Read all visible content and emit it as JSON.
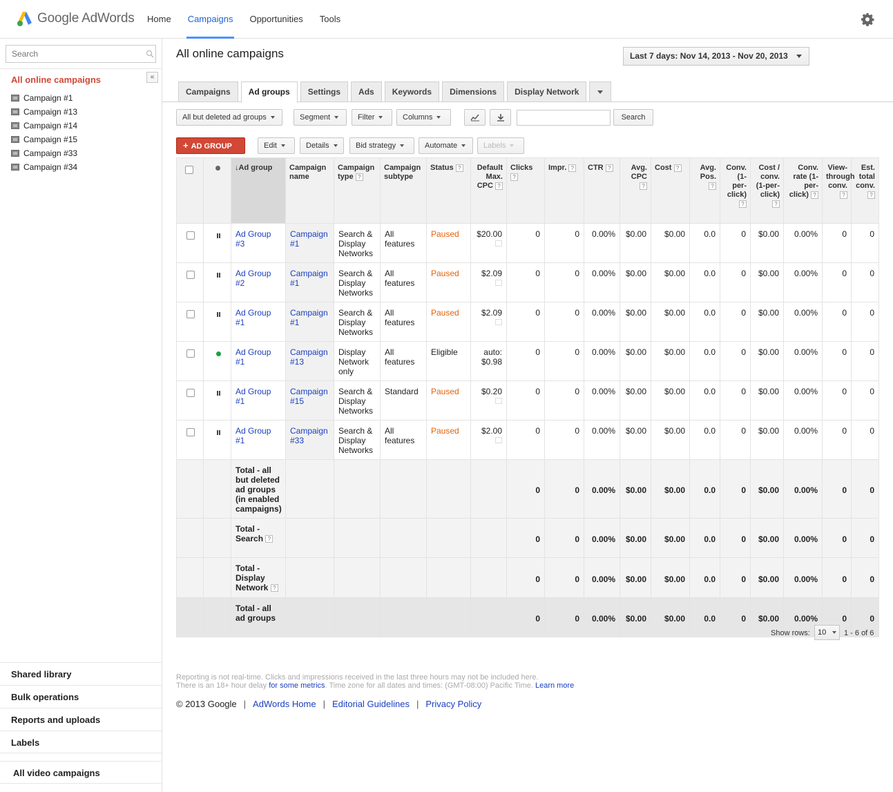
{
  "header": {
    "logo_google": "Google",
    "logo_adwords": "AdWords",
    "nav": [
      "Home",
      "Campaigns",
      "Opportunities",
      "Tools"
    ],
    "active_nav": "Campaigns"
  },
  "sidebar": {
    "search_placeholder": "Search",
    "collapse_label": "«",
    "all_campaigns": "All online campaigns",
    "campaigns": [
      "Campaign #1",
      "Campaign #13",
      "Campaign #14",
      "Campaign #15",
      "Campaign #33",
      "Campaign #34"
    ],
    "bottom_links": [
      "Shared library",
      "Bulk operations",
      "Reports and uploads",
      "Labels",
      "All video campaigns"
    ]
  },
  "main": {
    "title": "All online campaigns",
    "date_range": "Last 7 days: Nov 14, 2013 - Nov 20, 2013",
    "tabs": [
      "Campaigns",
      "Ad groups",
      "Settings",
      "Ads",
      "Keywords",
      "Dimensions",
      "Display Network"
    ],
    "active_tab": "Ad groups",
    "toolbar": {
      "filter_view": "All but deleted ad groups",
      "segment": "Segment",
      "filter": "Filter",
      "columns": "Columns",
      "search_button": "Search"
    },
    "actions": {
      "add": "AD GROUP",
      "edit": "Edit",
      "details": "Details",
      "bid_strategy": "Bid strategy",
      "automate": "Automate",
      "labels": "Labels"
    }
  },
  "table": {
    "headers": {
      "ad_group": "Ad group",
      "campaign_name": "Campaign name",
      "campaign_type": "Campaign type",
      "campaign_subtype": "Campaign subtype",
      "status": "Status",
      "default_cpc": "Default Max. CPC",
      "clicks": "Clicks",
      "impr": "Impr.",
      "ctr": "CTR",
      "avg_cpc": "Avg. CPC",
      "cost": "Cost",
      "avg_pos": "Avg. Pos.",
      "conv": "Conv. (1-per-click)",
      "cost_conv": "Cost / conv. (1-per-click)",
      "conv_rate": "Conv. rate (1-per-click)",
      "view_through": "View-through conv.",
      "est_total": "Est. total conv."
    },
    "rows": [
      {
        "state": "paused",
        "ad_group": "Ad Group #3",
        "campaign": "Campaign #1",
        "type": "Search & Display Networks",
        "subtype": "All features",
        "status": "Paused",
        "cpc": "$20.00",
        "clicks": "0",
        "impr": "0",
        "ctr": "0.00%",
        "avg_cpc": "$0.00",
        "cost": "$0.00",
        "avg_pos": "0.0",
        "conv": "0",
        "cost_conv": "$0.00",
        "conv_rate": "0.00%",
        "view_through": "0",
        "est_total": "0"
      },
      {
        "state": "paused",
        "ad_group": "Ad Group #2",
        "campaign": "Campaign #1",
        "type": "Search & Display Networks",
        "subtype": "All features",
        "status": "Paused",
        "cpc": "$2.09",
        "clicks": "0",
        "impr": "0",
        "ctr": "0.00%",
        "avg_cpc": "$0.00",
        "cost": "$0.00",
        "avg_pos": "0.0",
        "conv": "0",
        "cost_conv": "$0.00",
        "conv_rate": "0.00%",
        "view_through": "0",
        "est_total": "0"
      },
      {
        "state": "paused",
        "ad_group": "Ad Group #1",
        "campaign": "Campaign #1",
        "type": "Search & Display Networks",
        "subtype": "All features",
        "status": "Paused",
        "cpc": "$2.09",
        "clicks": "0",
        "impr": "0",
        "ctr": "0.00%",
        "avg_cpc": "$0.00",
        "cost": "$0.00",
        "avg_pos": "0.0",
        "conv": "0",
        "cost_conv": "$0.00",
        "conv_rate": "0.00%",
        "view_through": "0",
        "est_total": "0"
      },
      {
        "state": "eligible",
        "ad_group": "Ad Group #1",
        "campaign": "Campaign #13",
        "type": "Display Network only",
        "subtype": "All features",
        "status": "Eligible",
        "cpc": "auto: $0.98",
        "clicks": "0",
        "impr": "0",
        "ctr": "0.00%",
        "avg_cpc": "$0.00",
        "cost": "$0.00",
        "avg_pos": "0.0",
        "conv": "0",
        "cost_conv": "$0.00",
        "conv_rate": "0.00%",
        "view_through": "0",
        "est_total": "0"
      },
      {
        "state": "paused",
        "ad_group": "Ad Group #1",
        "campaign": "Campaign #15",
        "type": "Search & Display Networks",
        "subtype": "Standard",
        "status": "Paused",
        "cpc": "$0.20",
        "clicks": "0",
        "impr": "0",
        "ctr": "0.00%",
        "avg_cpc": "$0.00",
        "cost": "$0.00",
        "avg_pos": "0.0",
        "conv": "0",
        "cost_conv": "$0.00",
        "conv_rate": "0.00%",
        "view_through": "0",
        "est_total": "0"
      },
      {
        "state": "paused",
        "ad_group": "Ad Group #1",
        "campaign": "Campaign #33",
        "type": "Search & Display Networks",
        "subtype": "All features",
        "status": "Paused",
        "cpc": "$2.00",
        "clicks": "0",
        "impr": "0",
        "ctr": "0.00%",
        "avg_cpc": "$0.00",
        "cost": "$0.00",
        "avg_pos": "0.0",
        "conv": "0",
        "cost_conv": "$0.00",
        "conv_rate": "0.00%",
        "view_through": "0",
        "est_total": "0"
      }
    ],
    "totals": [
      {
        "label": "Total - all but deleted ad groups (in enabled campaigns)",
        "help": false,
        "clicks": "0",
        "impr": "0",
        "ctr": "0.00%",
        "avg_cpc": "$0.00",
        "cost": "$0.00",
        "avg_pos": "0.0",
        "conv": "0",
        "cost_conv": "$0.00",
        "conv_rate": "0.00%",
        "view_through": "0",
        "est_total": "0"
      },
      {
        "label": "Total - Search",
        "help": true,
        "clicks": "0",
        "impr": "0",
        "ctr": "0.00%",
        "avg_cpc": "$0.00",
        "cost": "$0.00",
        "avg_pos": "0.0",
        "conv": "0",
        "cost_conv": "$0.00",
        "conv_rate": "0.00%",
        "view_through": "0",
        "est_total": "0"
      },
      {
        "label": "Total - Display Network",
        "help": true,
        "clicks": "0",
        "impr": "0",
        "ctr": "0.00%",
        "avg_cpc": "$0.00",
        "cost": "$0.00",
        "avg_pos": "0.0",
        "conv": "0",
        "cost_conv": "$0.00",
        "conv_rate": "0.00%",
        "view_through": "0",
        "est_total": "0"
      },
      {
        "label": "Total - all ad groups",
        "help": false,
        "grand": true,
        "clicks": "0",
        "impr": "0",
        "ctr": "0.00%",
        "avg_cpc": "$0.00",
        "cost": "$0.00",
        "avg_pos": "0.0",
        "conv": "0",
        "cost_conv": "$0.00",
        "conv_rate": "0.00%",
        "view_through": "0",
        "est_total": "0"
      }
    ]
  },
  "pagination": {
    "show_rows_label": "Show rows:",
    "rows_value": "10",
    "range": "1 - 6 of 6"
  },
  "footnote": {
    "line1": "Reporting is not real-time. Clicks and impressions received in the last three hours may not be included here.",
    "line2_a": "There is an 18+ hour delay ",
    "line2_link": "for some metrics",
    "line2_b": ". Time zone for all dates and times: (GMT-08:00) Pacific Time. ",
    "learn_more": "Learn more"
  },
  "footer": {
    "copyright": "© 2013 Google",
    "links": [
      "AdWords Home",
      "Editorial Guidelines",
      "Privacy Policy"
    ]
  },
  "colors": {
    "accent_red": "#d14836",
    "paused_orange": "#e5620b",
    "link_blue": "#1a3fbf",
    "eligible_green": "#1fa145"
  }
}
